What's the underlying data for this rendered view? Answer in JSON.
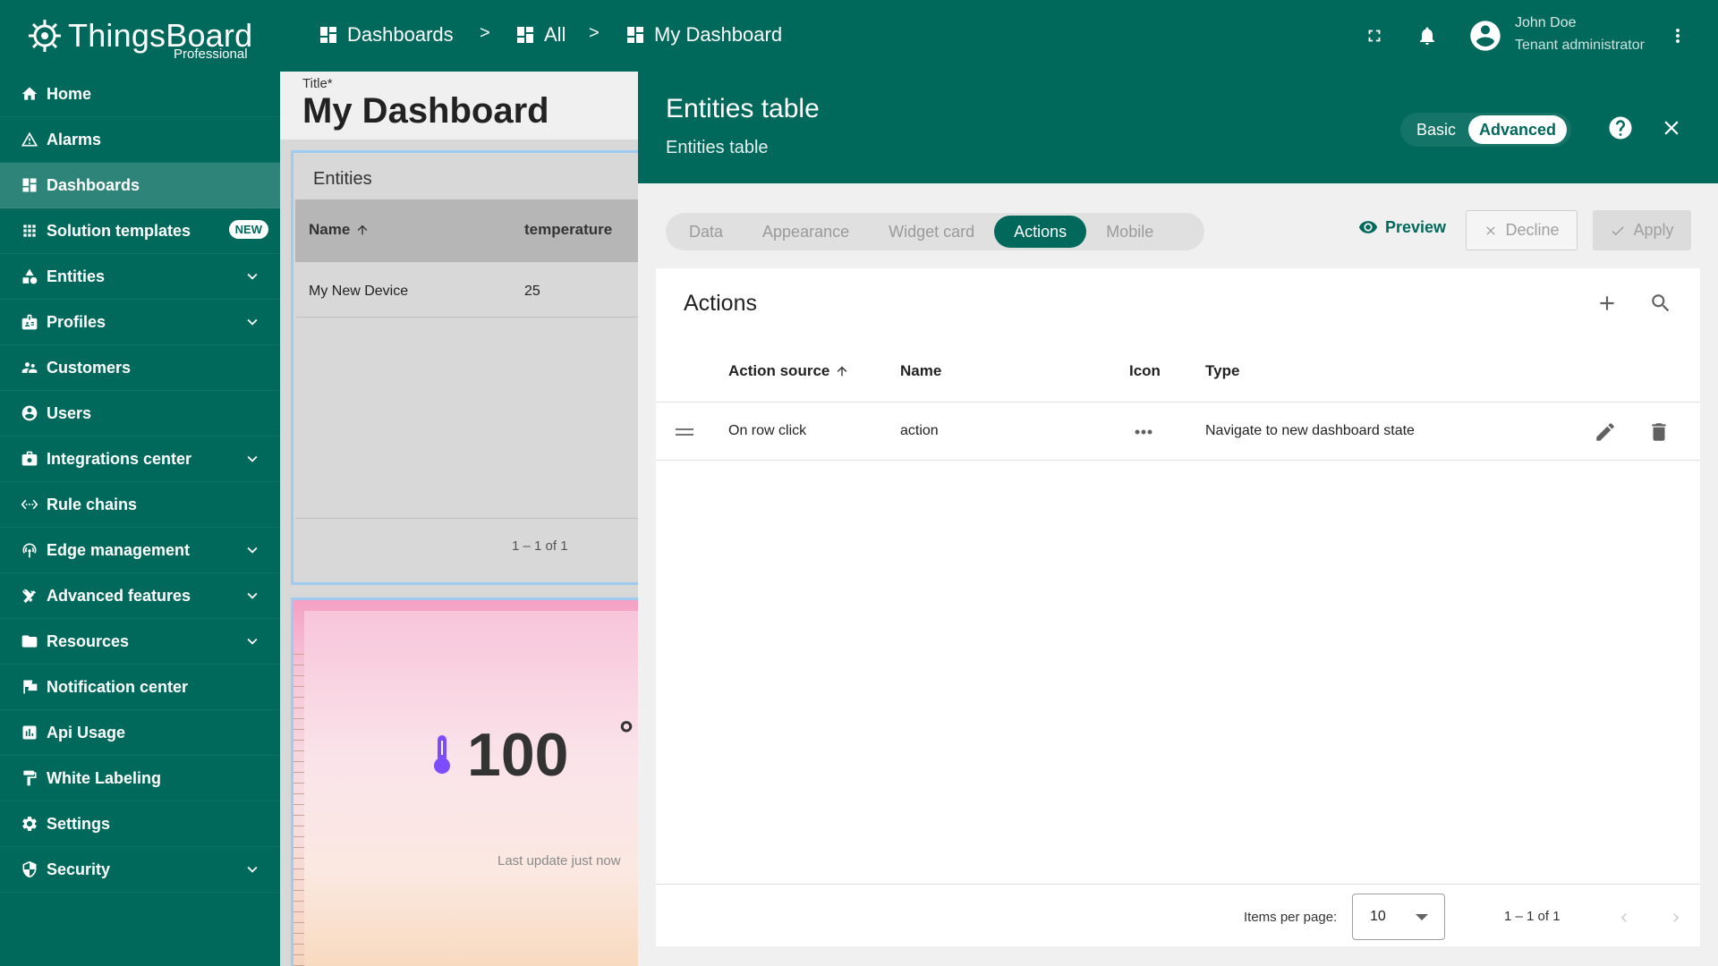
{
  "brand": {
    "name": "ThingsBoard",
    "edition": "Professional"
  },
  "sidebar": {
    "items": [
      {
        "label": "Home",
        "icon": "home-icon"
      },
      {
        "label": "Alarms",
        "icon": "warning-icon"
      },
      {
        "label": "Dashboards",
        "icon": "dashboard-icon",
        "active": true
      },
      {
        "label": "Solution templates",
        "icon": "apps-icon",
        "badge": "NEW"
      },
      {
        "label": "Entities",
        "icon": "entities-icon",
        "expandable": true
      },
      {
        "label": "Profiles",
        "icon": "badge-icon",
        "expandable": true
      },
      {
        "label": "Customers",
        "icon": "supervisor-icon"
      },
      {
        "label": "Users",
        "icon": "account-circle-icon"
      },
      {
        "label": "Integrations center",
        "icon": "integration-icon",
        "expandable": true
      },
      {
        "label": "Rule chains",
        "icon": "settings-ethernet-icon"
      },
      {
        "label": "Edge management",
        "icon": "router-icon",
        "expandable": true
      },
      {
        "label": "Advanced features",
        "icon": "construction-icon",
        "expandable": true
      },
      {
        "label": "Resources",
        "icon": "folder-icon",
        "expandable": true
      },
      {
        "label": "Notification center",
        "icon": "notification-flag-icon"
      },
      {
        "label": "Api Usage",
        "icon": "insert-chart-icon"
      },
      {
        "label": "White Labeling",
        "icon": "format-paint-icon"
      },
      {
        "label": "Settings",
        "icon": "gear-icon"
      },
      {
        "label": "Security",
        "icon": "security-icon",
        "expandable": true
      }
    ]
  },
  "topbar": {
    "breadcrumbs": [
      "Dashboards",
      "All",
      "My Dashboard"
    ],
    "separator": ">",
    "user": {
      "name": "John Doe",
      "role": "Tenant administrator"
    }
  },
  "dashboard": {
    "title_label": "Title*",
    "title": "My Dashboard",
    "entities_widget": {
      "title": "Entities",
      "columns": [
        "Name",
        "temperature"
      ],
      "rows": [
        [
          "My New Device",
          "25"
        ]
      ],
      "pagination": "1 – 1 of 1"
    },
    "temperature_widget": {
      "value": "100",
      "unit": "°",
      "update_text": "Last update just now"
    }
  },
  "panel": {
    "title": "Entities table",
    "subtitle": "Entities table",
    "mode": {
      "basic": "Basic",
      "advanced": "Advanced",
      "selected": "Advanced"
    },
    "tabs": [
      "Data",
      "Appearance",
      "Widget card",
      "Actions",
      "Mobile"
    ],
    "active_tab": "Actions",
    "buttons": {
      "preview": "Preview",
      "decline": "Decline",
      "apply": "Apply"
    },
    "actions": {
      "title": "Actions",
      "columns": [
        "Action source",
        "Name",
        "Icon",
        "Type"
      ],
      "rows": [
        {
          "source": "On row click",
          "name": "action",
          "icon": "more-horiz-icon",
          "type": "Navigate to new dashboard state"
        }
      ],
      "footer": {
        "items_per_page_label": "Items per page:",
        "items_per_page": "10",
        "range": "1 – 1 of 1"
      }
    }
  },
  "colors": {
    "primary": "#00695c",
    "sidebar_active": "#2e8377",
    "thermometer": "#7c4dff"
  }
}
